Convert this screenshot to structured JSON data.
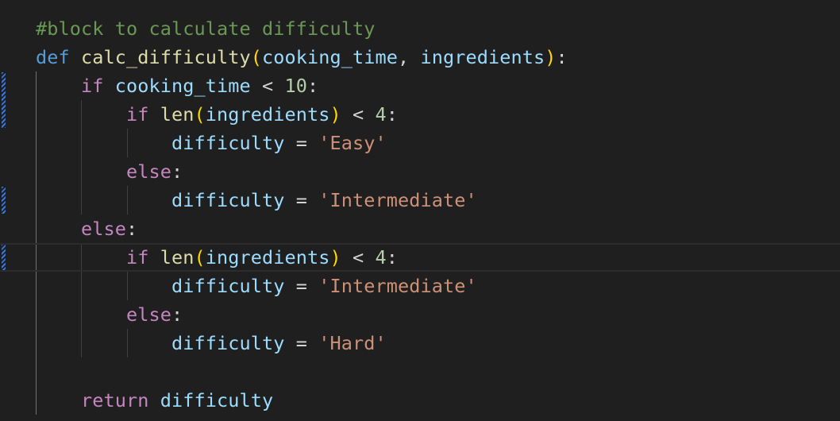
{
  "editor": {
    "language": "python",
    "theme_colors": {
      "background": "#1f1f1f",
      "comment": "#6a9955",
      "keyword": "#569cd6",
      "control": "#c586c0",
      "function": "#dcdcaa",
      "variable": "#9cdcfe",
      "number": "#b5cea8",
      "string": "#ce9178",
      "bracket_1": "#ffd700",
      "bracket_2": "#da70d6",
      "modified_marker": "#3a78d6"
    },
    "lines": [
      {
        "tokens": [
          {
            "t": "#block to calculate difficulty",
            "c": "comment"
          }
        ]
      },
      {
        "tokens": [
          {
            "t": "def",
            "c": "kw"
          },
          {
            "t": " ",
            "c": "op"
          },
          {
            "t": "calc_difficulty",
            "c": "fn"
          },
          {
            "t": "(",
            "c": "br1"
          },
          {
            "t": "cooking_time",
            "c": "var"
          },
          {
            "t": ", ",
            "c": "op"
          },
          {
            "t": "ingredients",
            "c": "var"
          },
          {
            "t": ")",
            "c": "br1"
          },
          {
            "t": ":",
            "c": "op"
          }
        ]
      },
      {
        "tokens": [
          {
            "t": "    ",
            "c": "op"
          },
          {
            "t": "if",
            "c": "ctrl"
          },
          {
            "t": " ",
            "c": "op"
          },
          {
            "t": "cooking_time",
            "c": "var"
          },
          {
            "t": " < ",
            "c": "op"
          },
          {
            "t": "10",
            "c": "num"
          },
          {
            "t": ":",
            "c": "op"
          }
        ]
      },
      {
        "tokens": [
          {
            "t": "        ",
            "c": "op"
          },
          {
            "t": "if",
            "c": "ctrl"
          },
          {
            "t": " ",
            "c": "op"
          },
          {
            "t": "len",
            "c": "fn"
          },
          {
            "t": "(",
            "c": "br1"
          },
          {
            "t": "ingredients",
            "c": "var"
          },
          {
            "t": ")",
            "c": "br1"
          },
          {
            "t": " < ",
            "c": "op"
          },
          {
            "t": "4",
            "c": "num"
          },
          {
            "t": ":",
            "c": "op"
          }
        ]
      },
      {
        "tokens": [
          {
            "t": "            ",
            "c": "op"
          },
          {
            "t": "difficulty",
            "c": "var"
          },
          {
            "t": " = ",
            "c": "op"
          },
          {
            "t": "'Easy'",
            "c": "str"
          }
        ]
      },
      {
        "tokens": [
          {
            "t": "        ",
            "c": "op"
          },
          {
            "t": "else",
            "c": "ctrl"
          },
          {
            "t": ":",
            "c": "op"
          }
        ]
      },
      {
        "tokens": [
          {
            "t": "            ",
            "c": "op"
          },
          {
            "t": "difficulty",
            "c": "var"
          },
          {
            "t": " = ",
            "c": "op"
          },
          {
            "t": "'Intermediate'",
            "c": "str"
          }
        ]
      },
      {
        "tokens": [
          {
            "t": "    ",
            "c": "op"
          },
          {
            "t": "else",
            "c": "ctrl"
          },
          {
            "t": ":",
            "c": "op"
          }
        ]
      },
      {
        "tokens": [
          {
            "t": "        ",
            "c": "op"
          },
          {
            "t": "if",
            "c": "ctrl"
          },
          {
            "t": " ",
            "c": "op"
          },
          {
            "t": "len",
            "c": "fn"
          },
          {
            "t": "(",
            "c": "br1"
          },
          {
            "t": "ingredients",
            "c": "var"
          },
          {
            "t": ")",
            "c": "br1"
          },
          {
            "t": " < ",
            "c": "op"
          },
          {
            "t": "4",
            "c": "num"
          },
          {
            "t": ":",
            "c": "op"
          }
        ],
        "current": true
      },
      {
        "tokens": [
          {
            "t": "            ",
            "c": "op"
          },
          {
            "t": "difficulty",
            "c": "var"
          },
          {
            "t": " = ",
            "c": "op"
          },
          {
            "t": "'Intermediate'",
            "c": "str"
          }
        ]
      },
      {
        "tokens": [
          {
            "t": "        ",
            "c": "op"
          },
          {
            "t": "else",
            "c": "ctrl"
          },
          {
            "t": ":",
            "c": "op"
          }
        ]
      },
      {
        "tokens": [
          {
            "t": "            ",
            "c": "op"
          },
          {
            "t": "difficulty",
            "c": "var"
          },
          {
            "t": " = ",
            "c": "op"
          },
          {
            "t": "'Hard'",
            "c": "str"
          }
        ]
      },
      {
        "tokens": []
      },
      {
        "tokens": [
          {
            "t": "    ",
            "c": "op"
          },
          {
            "t": "return",
            "c": "ctrl"
          },
          {
            "t": " ",
            "c": "op"
          },
          {
            "t": "difficulty",
            "c": "var"
          }
        ]
      }
    ]
  }
}
